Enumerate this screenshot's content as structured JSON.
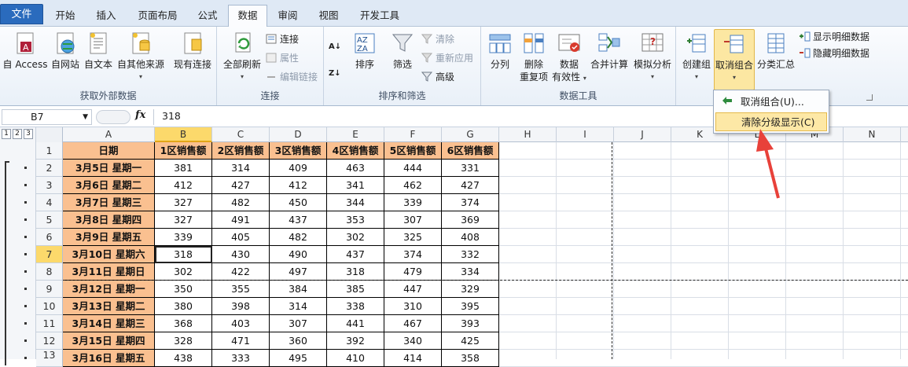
{
  "tabs": [
    "文件",
    "开始",
    "插入",
    "页面布局",
    "公式",
    "数据",
    "审阅",
    "视图",
    "开发工具"
  ],
  "ribbon": {
    "ext": {
      "label": "获取外部数据",
      "access": "自 Access",
      "web": "自网站",
      "text": "自文本",
      "other": "自其他来源",
      "existing": "现有连接"
    },
    "conn": {
      "label": "连接",
      "refresh": "全部刷新",
      "connections": "连接",
      "properties": "属性",
      "editlinks": "编辑链接"
    },
    "sort": {
      "label": "排序和筛选",
      "sort": "排序",
      "filter": "筛选",
      "clear": "清除",
      "reapply": "重新应用",
      "advanced": "高级"
    },
    "tools": {
      "label": "数据工具",
      "split": "分列",
      "dedupe1": "删除",
      "dedupe2": "重复项",
      "valid1": "数据",
      "valid2": "有效性",
      "consolidate": "合并计算",
      "whatif": "模拟分析"
    },
    "outline": {
      "group": "创建组",
      "ungroup": "取消组合",
      "subtotal": "分类汇总",
      "show": "显示明细数据",
      "hide": "隐藏明细数据"
    }
  },
  "menu": {
    "item1": "取消组合(U)...",
    "item2": "清除分级显示(C)"
  },
  "formula": {
    "namebox": "B7",
    "fx": "fx",
    "content": "318"
  },
  "sheet": {
    "columns": [
      "A",
      "B",
      "C",
      "D",
      "E",
      "F",
      "G",
      "H",
      "I",
      "J",
      "K",
      "L",
      "M",
      "N"
    ],
    "row_numbers": [
      "1",
      "2",
      "3",
      "4",
      "5",
      "6",
      "7",
      "8",
      "9",
      "10",
      "11",
      "12",
      "13"
    ],
    "levels": [
      "1",
      "2",
      "3"
    ],
    "headers": [
      "日期",
      "1区销售额",
      "2区销售额",
      "3区销售额",
      "4区销售额",
      "5区销售额",
      "6区销售额"
    ],
    "rows": [
      [
        "3月5日 星期一",
        "381",
        "314",
        "409",
        "463",
        "444",
        "331"
      ],
      [
        "3月6日 星期二",
        "412",
        "427",
        "412",
        "341",
        "462",
        "427"
      ],
      [
        "3月7日 星期三",
        "327",
        "482",
        "450",
        "344",
        "339",
        "374"
      ],
      [
        "3月8日 星期四",
        "327",
        "491",
        "437",
        "353",
        "307",
        "369"
      ],
      [
        "3月9日 星期五",
        "339",
        "405",
        "482",
        "302",
        "325",
        "408"
      ],
      [
        "3月10日 星期六",
        "318",
        "430",
        "490",
        "437",
        "374",
        "332"
      ],
      [
        "3月11日 星期日",
        "302",
        "422",
        "497",
        "318",
        "479",
        "334"
      ],
      [
        "3月12日 星期一",
        "350",
        "355",
        "384",
        "385",
        "447",
        "329"
      ],
      [
        "3月13日 星期二",
        "380",
        "398",
        "314",
        "338",
        "310",
        "395"
      ],
      [
        "3月14日 星期三",
        "368",
        "403",
        "307",
        "441",
        "467",
        "393"
      ],
      [
        "3月15日 星期四",
        "328",
        "471",
        "360",
        "392",
        "340",
        "425"
      ],
      [
        "3月16日 星期五",
        "438",
        "333",
        "495",
        "410",
        "414",
        "358"
      ]
    ]
  },
  "colors": {
    "header_fill": "#fac090",
    "selected": "#fcd96b",
    "accent": "#e8413a"
  }
}
